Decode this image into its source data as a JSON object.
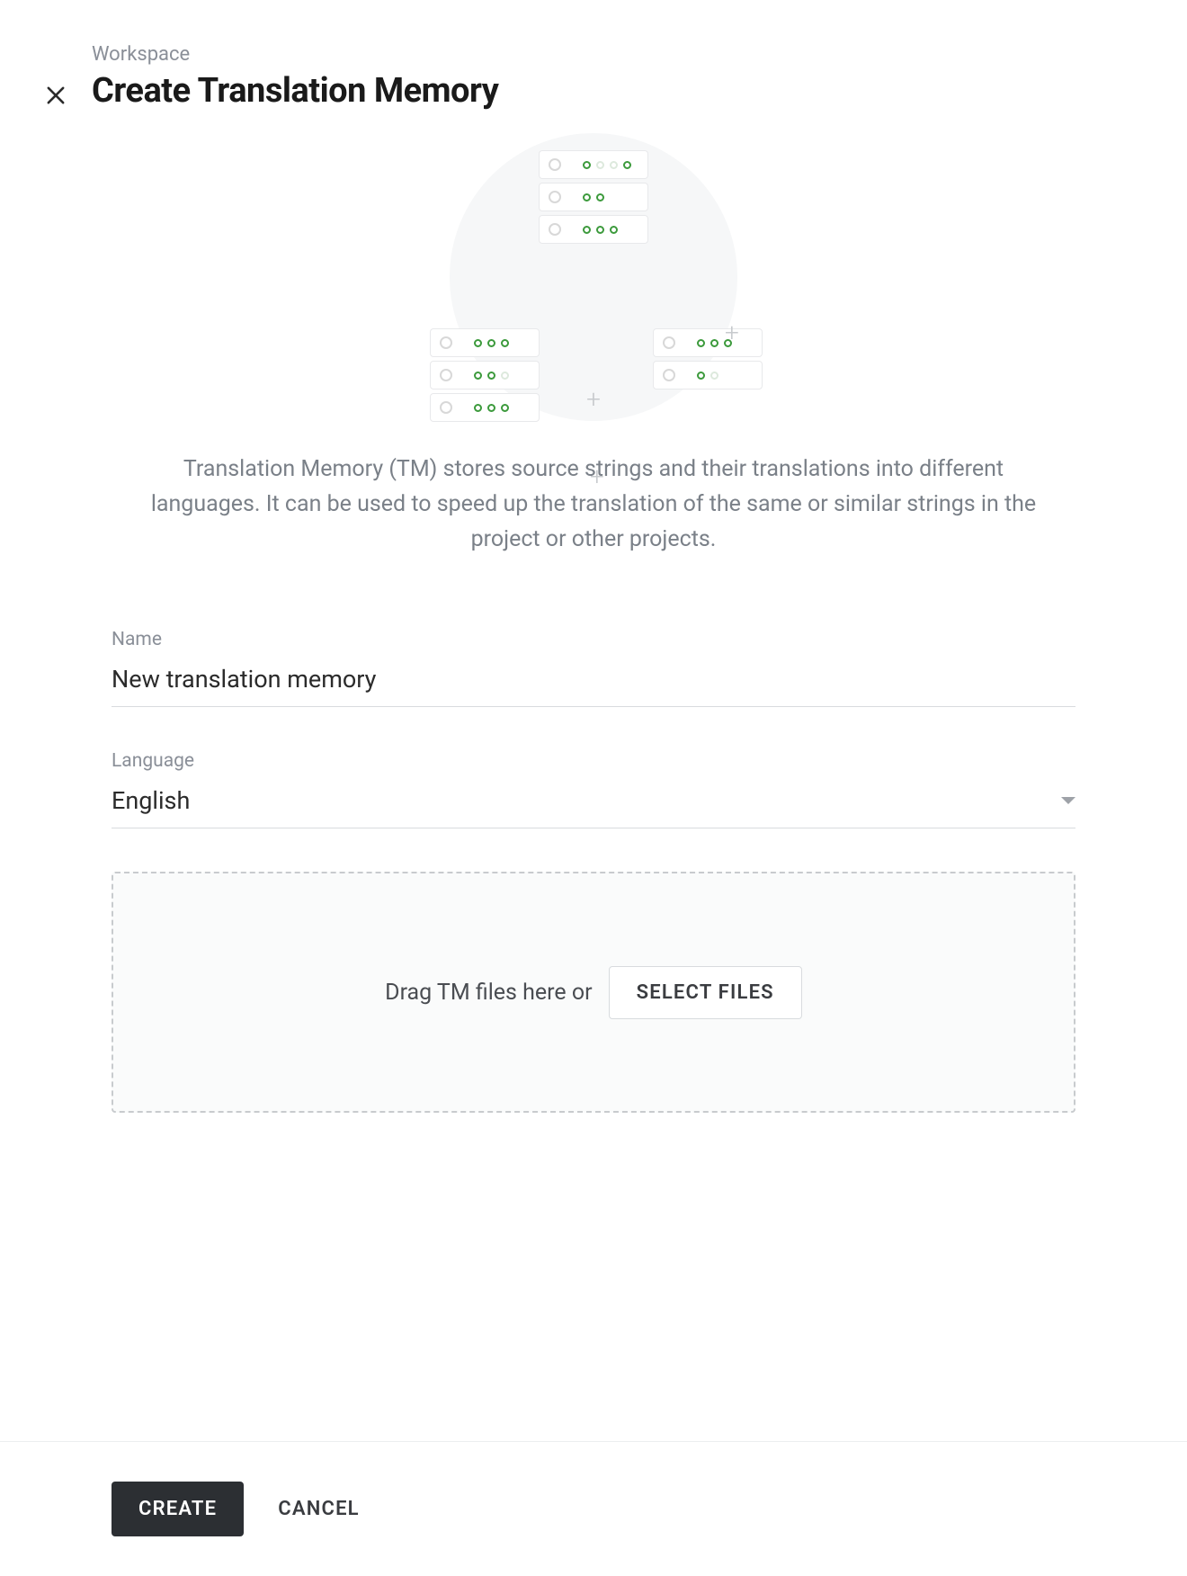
{
  "header": {
    "breadcrumb": "Workspace",
    "title": "Create Translation Memory"
  },
  "description": "Translation Memory (TM) stores source strings and their translations into different languages. It can be used to speed up the translation of the same or similar strings in the project or other projects.",
  "form": {
    "name": {
      "label": "Name",
      "value": "New translation memory"
    },
    "language": {
      "label": "Language",
      "value": "English"
    },
    "dropzone": {
      "text": "Drag TM files here or",
      "button": "SELECT FILES"
    }
  },
  "footer": {
    "create": "CREATE",
    "cancel": "CANCEL"
  }
}
